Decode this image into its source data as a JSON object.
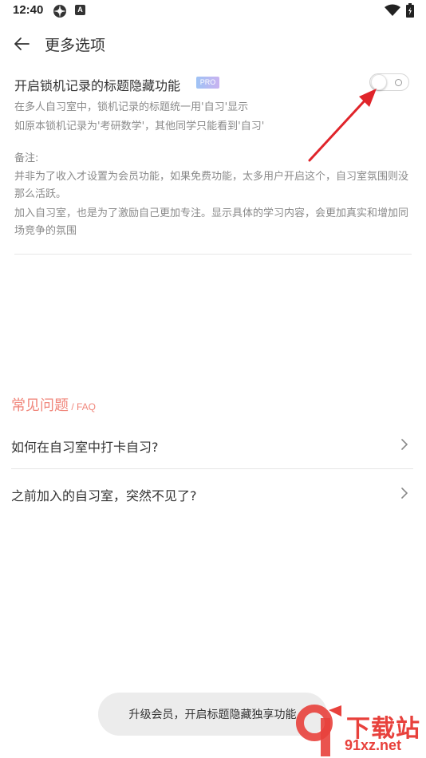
{
  "status_bar": {
    "time": "12:40",
    "icons": [
      "settings-gear-icon",
      "a-letter-icon",
      "wifi-icon",
      "battery-icon"
    ]
  },
  "header": {
    "back_icon": "arrow-left-icon",
    "title": "更多选项"
  },
  "option": {
    "title": "开启锁机记录的标题隐藏功能",
    "badge": "PRO",
    "toggle_state": "off",
    "desc_line1": "在多人自习室中，锁机记录的标题统一用'自习'显示",
    "desc_line2": "如原本锁机记录为'考研数学'，其他同学只能看到'自习'",
    "note_label": "备注:",
    "note_p1": "并非为了收入才设置为会员功能，如果免费功能，太多用户开启这个，自习室氛围则没那么活跃。",
    "note_p2": "加入自习室，也是为了激励自己更加专注。显示具体的学习内容，会更加真实和增加同场竞争的氛围"
  },
  "faq": {
    "title": "常见问题",
    "subtitle": " / FAQ",
    "items": [
      {
        "label": "如何在自习室中打卡自习?"
      },
      {
        "label": "之前加入的自习室，突然不见了?"
      }
    ]
  },
  "toast": {
    "text": "升级会员，开启标题隐藏独享功能"
  },
  "watermark": {
    "text_top": "下载站",
    "text_bottom": "91xz.net"
  },
  "colors": {
    "accent": "#f0867b",
    "arrow": "#e0242a",
    "text": "#333333",
    "muted": "#8a8a8a"
  }
}
